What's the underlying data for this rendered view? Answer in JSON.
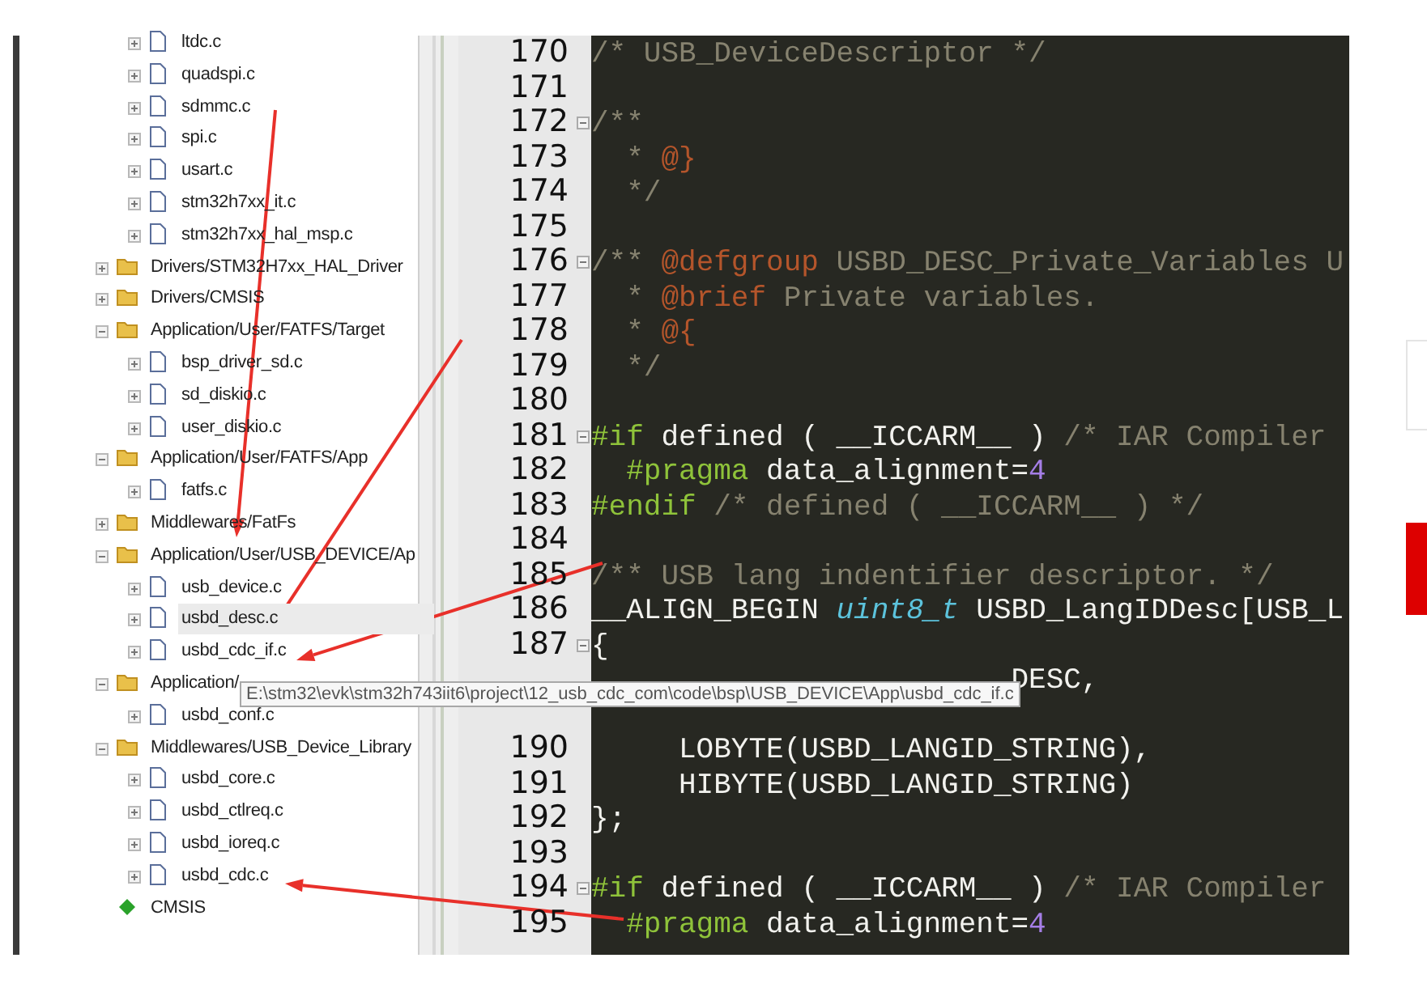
{
  "tree": {
    "continued_children": [
      {
        "kind": "file",
        "label": "ltdc.c",
        "selected": false
      },
      {
        "kind": "file",
        "label": "quadspi.c",
        "selected": false
      },
      {
        "kind": "file",
        "label": "sdmmc.c",
        "selected": false
      },
      {
        "kind": "file",
        "label": "spi.c",
        "selected": false
      },
      {
        "kind": "file",
        "label": "usart.c",
        "selected": false
      },
      {
        "kind": "file",
        "label": "stm32h7xx_it.c",
        "selected": false
      },
      {
        "kind": "file",
        "label": "stm32h7xx_hal_msp.c",
        "selected": false
      }
    ],
    "items": [
      {
        "kind": "folder",
        "label": "Drivers/STM32H7xx_HAL_Driver",
        "expanded": false,
        "selected": false
      },
      {
        "kind": "folder",
        "label": "Drivers/CMSIS",
        "expanded": false,
        "selected": false
      },
      {
        "kind": "folder",
        "label": "Application/User/FATFS/Target",
        "expanded": true,
        "selected": false,
        "children": [
          {
            "kind": "file",
            "label": "bsp_driver_sd.c",
            "selected": false
          },
          {
            "kind": "file",
            "label": "sd_diskio.c",
            "selected": false
          },
          {
            "kind": "file",
            "label": "user_diskio.c",
            "selected": false
          }
        ]
      },
      {
        "kind": "folder",
        "label": "Application/User/FATFS/App",
        "expanded": true,
        "selected": false,
        "children": [
          {
            "kind": "file",
            "label": "fatfs.c",
            "selected": false
          }
        ]
      },
      {
        "kind": "folder",
        "label": "Middlewares/FatFs",
        "expanded": false,
        "selected": false
      },
      {
        "kind": "folder",
        "label": "Application/User/USB_DEVICE/Ap",
        "expanded": true,
        "selected": false,
        "children": [
          {
            "kind": "file",
            "label": "usb_device.c",
            "selected": false
          },
          {
            "kind": "file",
            "label": "usbd_desc.c",
            "selected": true
          },
          {
            "kind": "file",
            "label": "usbd_cdc_if.c",
            "selected": false
          }
        ]
      },
      {
        "kind": "folder",
        "label": "Application/",
        "expanded": true,
        "selected": false,
        "children": [
          {
            "kind": "file",
            "label": "usbd_conf.c",
            "selected": false
          }
        ]
      },
      {
        "kind": "folder",
        "label": "Middlewares/USB_Device_Library",
        "expanded": true,
        "selected": false,
        "children": [
          {
            "kind": "file",
            "label": "usbd_core.c",
            "selected": false
          },
          {
            "kind": "file",
            "label": "usbd_ctlreq.c",
            "selected": false
          },
          {
            "kind": "file",
            "label": "usbd_ioreq.c",
            "selected": false
          },
          {
            "kind": "file",
            "label": "usbd_cdc.c",
            "selected": false
          }
        ]
      },
      {
        "kind": "component",
        "label": "CMSIS",
        "selected": false
      }
    ]
  },
  "tooltip": "E:\\stm32\\evk\\stm32h743iit6\\project\\12_usb_cdc_com\\code\\bsp\\USB_DEVICE\\App\\usbd_cdc_if.c",
  "editor": {
    "lines": [
      {
        "number": "170",
        "fold": false,
        "tokens": [
          {
            "kind": "comment",
            "text": "/* USB_DeviceDescriptor */"
          }
        ]
      },
      {
        "number": "171",
        "fold": false
      },
      {
        "number": "172",
        "fold": true,
        "tokens": [
          {
            "kind": "comment",
            "text": "/**"
          }
        ]
      },
      {
        "number": "173",
        "fold": false,
        "tokens": [
          {
            "kind": "comment",
            "text": "  * "
          },
          {
            "kind": "tag",
            "text": "@}"
          }
        ]
      },
      {
        "number": "174",
        "fold": false,
        "tokens": [
          {
            "kind": "comment",
            "text": "  */"
          }
        ]
      },
      {
        "number": "175",
        "fold": false
      },
      {
        "number": "176",
        "fold": true,
        "tokens": [
          {
            "kind": "comment",
            "text": "/** "
          },
          {
            "kind": "tag",
            "text": "@defgroup"
          },
          {
            "kind": "comment",
            "text": " USBD_DESC_Private_Variables U"
          }
        ]
      },
      {
        "number": "177",
        "fold": false,
        "tokens": [
          {
            "kind": "comment",
            "text": "  * "
          },
          {
            "kind": "tag",
            "text": "@brief"
          },
          {
            "kind": "comment",
            "text": " Private variables."
          }
        ]
      },
      {
        "number": "178",
        "fold": false,
        "tokens": [
          {
            "kind": "comment",
            "text": "  * "
          },
          {
            "kind": "tag",
            "text": "@{"
          }
        ]
      },
      {
        "number": "179",
        "fold": false,
        "tokens": [
          {
            "kind": "comment",
            "text": "  */"
          }
        ]
      },
      {
        "number": "180",
        "fold": false
      },
      {
        "number": "181",
        "fold": true,
        "tokens": [
          {
            "kind": "keyword",
            "text": "#if"
          },
          {
            "kind": "plain",
            "text": " defined ( __ICCARM__ ) "
          },
          {
            "kind": "comment",
            "text": "/* IAR Compiler"
          }
        ]
      },
      {
        "number": "182",
        "fold": false,
        "tokens": [
          {
            "kind": "keyword",
            "text": "  #pragma"
          },
          {
            "kind": "plain",
            "text": " data_alignment="
          },
          {
            "kind": "number",
            "text": "4"
          }
        ]
      },
      {
        "number": "183",
        "fold": false,
        "tokens": [
          {
            "kind": "keyword",
            "text": "#endif"
          },
          {
            "kind": "comment",
            "text": " /* defined ( __ICCARM__ ) */"
          }
        ]
      },
      {
        "number": "184",
        "fold": false
      },
      {
        "number": "185",
        "fold": false,
        "tokens": [
          {
            "kind": "comment",
            "text": "/** USB lang indentifier descriptor. */"
          }
        ]
      },
      {
        "number": "186",
        "fold": false,
        "tokens": [
          {
            "kind": "plain",
            "text": "__ALIGN_BEGIN "
          },
          {
            "kind": "type",
            "text": "uint8_t"
          },
          {
            "kind": "plain",
            "text": " USBD_LangIDDesc[USB_L"
          }
        ]
      },
      {
        "number": "187",
        "fold": true,
        "tokens": [
          {
            "kind": "plain",
            "text": "{"
          }
        ]
      },
      {
        "fold": false,
        "tokens": [
          {
            "kind": "plain",
            "text": "                        DESC,"
          }
        ]
      },
      {
        "fold": false
      },
      {
        "number": "190",
        "fold": false,
        "tokens": [
          {
            "kind": "plain",
            "text": "     LOBYTE(USBD_LANGID_STRING),"
          }
        ]
      },
      {
        "number": "191",
        "fold": false,
        "tokens": [
          {
            "kind": "plain",
            "text": "     HIBYTE(USBD_LANGID_STRING)"
          }
        ]
      },
      {
        "number": "192",
        "fold": false,
        "tokens": [
          {
            "kind": "plain",
            "text": "};"
          }
        ]
      },
      {
        "number": "193",
        "fold": false
      },
      {
        "number": "194",
        "fold": true,
        "tokens": [
          {
            "kind": "keyword",
            "text": "#if"
          },
          {
            "kind": "plain",
            "text": " defined ( __ICCARM__ ) "
          },
          {
            "kind": "comment",
            "text": "/* IAR Compiler"
          }
        ]
      },
      {
        "number": "195",
        "fold": false,
        "tokens": [
          {
            "kind": "keyword",
            "text": "  #pragma"
          },
          {
            "kind": "plain",
            "text": " data_alignment="
          },
          {
            "kind": "number",
            "text": "4"
          }
        ]
      }
    ]
  }
}
